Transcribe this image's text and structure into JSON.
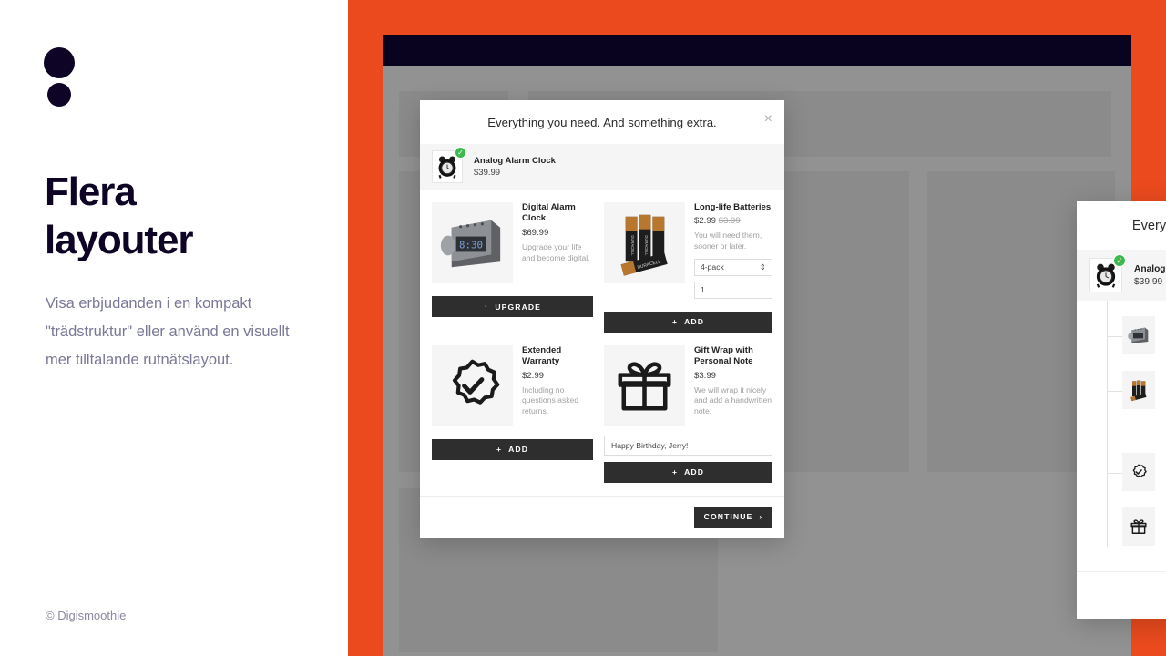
{
  "colors": {
    "accent_orange": "#ea4a1e",
    "ink": "#0d0426",
    "header_navy": "#0a0320",
    "muted_text": "#797897",
    "button_dark": "#2e2e2e",
    "badge_green": "#3eb950"
  },
  "left_panel": {
    "logo_name": "digismoothie-logo",
    "headline_line1": "Flera",
    "headline_line2": "layouter",
    "subcopy": "Visa erbjudanden i en kompakt \"trädstruktur\" eller använd en visuellt mer tilltalande rutnätslayout.",
    "copyright": "© Digismoothie"
  },
  "modal": {
    "title": "Everything you need. And something extra.",
    "close_label": "×",
    "parent_product": {
      "name": "Analog Alarm Clock",
      "price": "$39.99",
      "image": "analog-alarm-clock",
      "selected_badge": "✓"
    },
    "continue_label": "CONTINUE",
    "continue_chevron": "›",
    "offers": [
      {
        "id": "digital-alarm-clock",
        "name": "Digital Alarm Clock",
        "price": "$69.99",
        "old_price": "",
        "description": "Upgrade your life and become digital.",
        "image": "digital-alarm-clock",
        "action_label": "UPGRADE",
        "action_icon": "↑",
        "has_quantity": false,
        "quantity": "",
        "select_value": "",
        "note_value": ""
      },
      {
        "id": "long-life-batteries",
        "name": "Long-life Batteries",
        "price": "$2.99",
        "old_price": "$3.99",
        "description": "You will need them, sooner or later.",
        "image": "batteries",
        "action_label": "ADD",
        "action_icon": "+",
        "has_quantity": true,
        "quantity": "1",
        "select_value": "4-pack",
        "note_value": ""
      },
      {
        "id": "extended-warranty",
        "name": "Extended Warranty",
        "price": "$2.99",
        "old_price": "",
        "description": "Including no questions asked returns.",
        "image": "warranty-badge-icon",
        "action_label": "ADD",
        "action_icon": "+",
        "has_quantity": false,
        "quantity": "",
        "select_value": "",
        "note_value": ""
      },
      {
        "id": "gift-wrap",
        "name": "Gift Wrap with Personal Note",
        "price": "$3.99",
        "old_price": "",
        "description": "We will wrap it nicely and add a handwritten note.",
        "image": "gift-icon",
        "action_label": "ADD",
        "action_icon": "+",
        "has_quantity": false,
        "quantity": "",
        "select_value": "",
        "note_value": "Happy Birthday, Jerry!"
      }
    ],
    "grid_variant": {
      "gift_wrap_name_wrapped": "Gift Wrap with Personal Note",
      "note_value": "Happy Birthday, Jerry!"
    }
  }
}
